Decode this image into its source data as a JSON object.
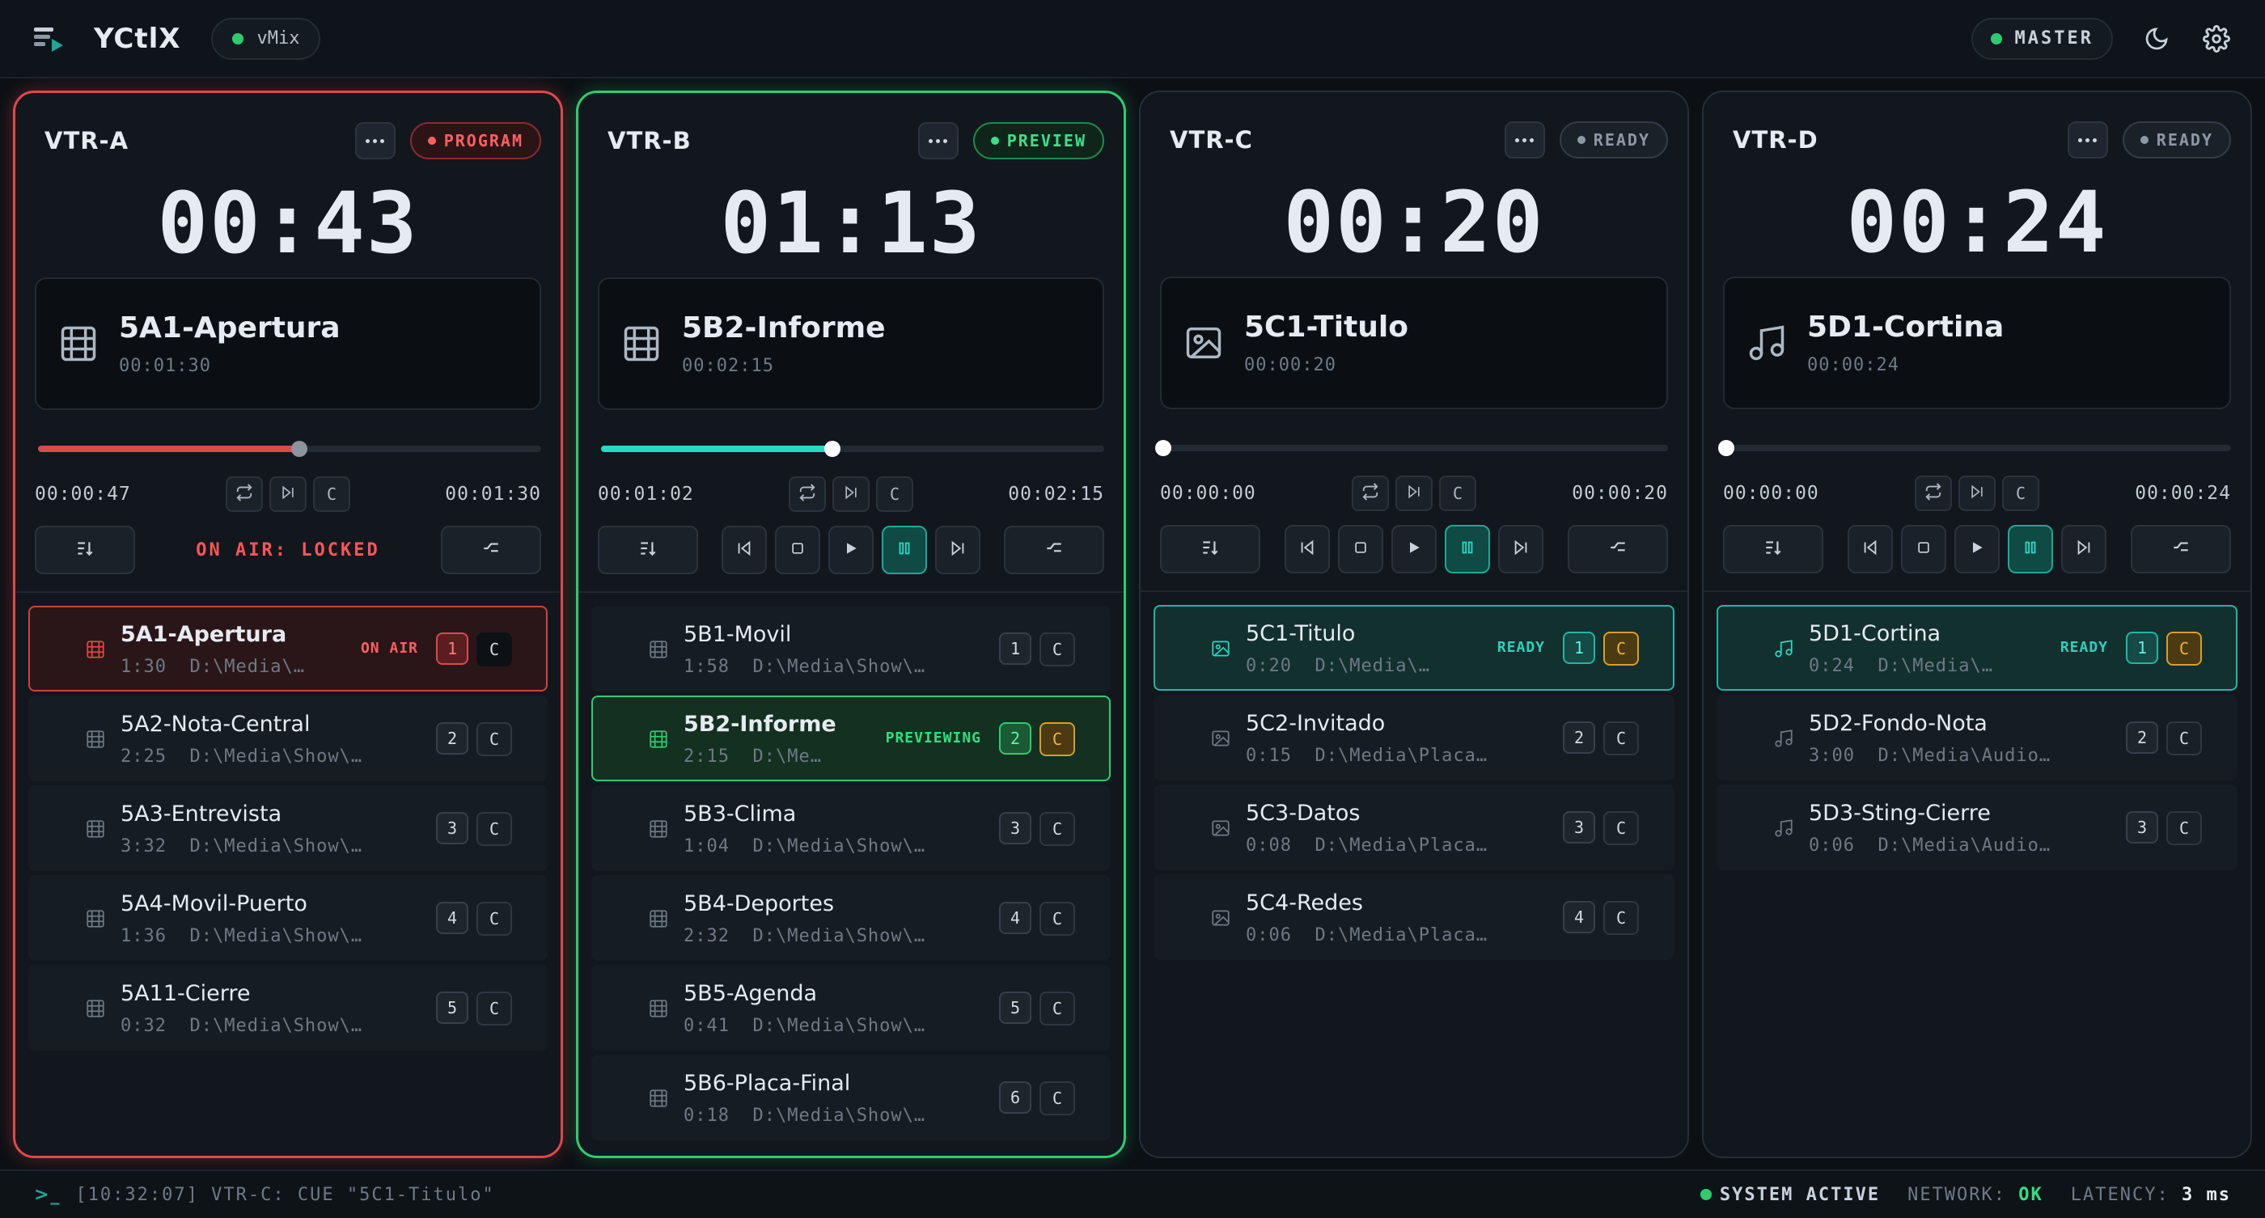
{
  "app": {
    "title": "YCtlX",
    "connection": "vMix",
    "mode": "MASTER"
  },
  "colors": {
    "program": "#e04848",
    "preview": "#2ecc71",
    "ready": "#20b7a6",
    "cue": "#d99d2b"
  },
  "vtrs": [
    {
      "name": "VTR-A",
      "state": "PROGRAM",
      "timer": "00:43",
      "clip": {
        "name": "5A1-Apertura",
        "duration": "00:01:30",
        "icon": "film-icon"
      },
      "elapsed": "00:00:47",
      "total": "00:01:30",
      "progress": 0.52,
      "locked_label": "ON AIR: LOCKED",
      "items": [
        {
          "name": "5A1-Apertura",
          "dur": "1:30",
          "path": "D:\\Media\\…",
          "num": "1",
          "cue": "C",
          "status": "ON AIR"
        },
        {
          "name": "5A2-Nota-Central",
          "dur": "2:25",
          "path": "D:\\Media\\Show\\…",
          "num": "2",
          "cue": "C",
          "status": ""
        },
        {
          "name": "5A3-Entrevista",
          "dur": "3:32",
          "path": "D:\\Media\\Show\\…",
          "num": "3",
          "cue": "C",
          "status": ""
        },
        {
          "name": "5A4-Movil-Puerto",
          "dur": "1:36",
          "path": "D:\\Media\\Show\\…",
          "num": "4",
          "cue": "C",
          "status": ""
        },
        {
          "name": "5A11-Cierre",
          "dur": "0:32",
          "path": "D:\\Media\\Show\\…",
          "num": "5",
          "cue": "C",
          "status": ""
        }
      ]
    },
    {
      "name": "VTR-B",
      "state": "PREVIEW",
      "timer": "01:13",
      "clip": {
        "name": "5B2-Informe",
        "duration": "00:02:15",
        "icon": "film-icon"
      },
      "elapsed": "00:01:02",
      "total": "00:02:15",
      "progress": 0.46,
      "items": [
        {
          "name": "5B1-Movil",
          "dur": "1:58",
          "path": "D:\\Media\\Show\\…",
          "num": "1",
          "cue": "C",
          "status": ""
        },
        {
          "name": "5B2-Informe",
          "dur": "2:15",
          "path": "D:\\Me…",
          "num": "2",
          "cue": "C",
          "status": "PREVIEWING"
        },
        {
          "name": "5B3-Clima",
          "dur": "1:04",
          "path": "D:\\Media\\Show\\…",
          "num": "3",
          "cue": "C",
          "status": ""
        },
        {
          "name": "5B4-Deportes",
          "dur": "2:32",
          "path": "D:\\Media\\Show\\…",
          "num": "4",
          "cue": "C",
          "status": ""
        },
        {
          "name": "5B5-Agenda",
          "dur": "0:41",
          "path": "D:\\Media\\Show\\…",
          "num": "5",
          "cue": "C",
          "status": ""
        },
        {
          "name": "5B6-Placa-Final",
          "dur": "0:18",
          "path": "D:\\Media\\Show\\…",
          "num": "6",
          "cue": "C",
          "status": ""
        }
      ]
    },
    {
      "name": "VTR-C",
      "state": "READY",
      "timer": "00:20",
      "clip": {
        "name": "5C1-Titulo",
        "duration": "00:00:20",
        "icon": "image-icon"
      },
      "elapsed": "00:00:00",
      "total": "00:00:20",
      "progress": 0,
      "items": [
        {
          "name": "5C1-Titulo",
          "dur": "0:20",
          "path": "D:\\Media\\…",
          "num": "1",
          "cue": "C",
          "status": "READY"
        },
        {
          "name": "5C2-Invitado",
          "dur": "0:15",
          "path": "D:\\Media\\Placa…",
          "num": "2",
          "cue": "C",
          "status": ""
        },
        {
          "name": "5C3-Datos",
          "dur": "0:08",
          "path": "D:\\Media\\Placa…",
          "num": "3",
          "cue": "C",
          "status": ""
        },
        {
          "name": "5C4-Redes",
          "dur": "0:06",
          "path": "D:\\Media\\Placa…",
          "num": "4",
          "cue": "C",
          "status": ""
        }
      ]
    },
    {
      "name": "VTR-D",
      "state": "READY",
      "timer": "00:24",
      "clip": {
        "name": "5D1-Cortina",
        "duration": "00:00:24",
        "icon": "music-icon"
      },
      "elapsed": "00:00:00",
      "total": "00:00:24",
      "progress": 0,
      "items": [
        {
          "name": "5D1-Cortina",
          "dur": "0:24",
          "path": "D:\\Media\\…",
          "num": "1",
          "cue": "C",
          "status": "READY"
        },
        {
          "name": "5D2-Fondo-Nota",
          "dur": "3:00",
          "path": "D:\\Media\\Audio…",
          "num": "2",
          "cue": "C",
          "status": ""
        },
        {
          "name": "5D3-Sting-Cierre",
          "dur": "0:06",
          "path": "D:\\Media\\Audio…",
          "num": "3",
          "cue": "C",
          "status": ""
        }
      ]
    }
  ],
  "small_controls": {
    "cue_label": "C"
  },
  "statusbar": {
    "log": "[10:32:07] VTR-C: CUE \"5C1-Titulo\"",
    "system": "SYSTEM ACTIVE",
    "network_label": "NETWORK:",
    "network_value": "OK",
    "latency_label": "LATENCY:",
    "latency_value": "3 ms"
  }
}
